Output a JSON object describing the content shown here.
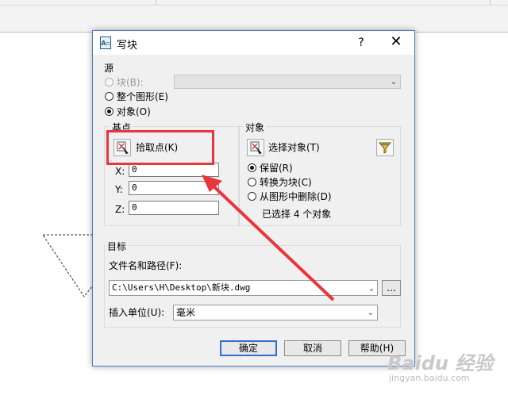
{
  "dialog": {
    "title": "写块",
    "app_icon": "A▫",
    "help_glyph": "?",
    "close_glyph": "✕",
    "source": {
      "label": "源",
      "block_option": "块(B):",
      "entire_drawing_option": "整个图形(E)",
      "objects_option": "对象(O)",
      "selected": "objects"
    },
    "base_point": {
      "label": "基点",
      "pick_point_label": "拾取点(K)",
      "x_label": "X:",
      "y_label": "Y:",
      "z_label": "Z:",
      "x_value": "0",
      "y_value": "0",
      "z_value": "0"
    },
    "objects": {
      "label": "对象",
      "select_objects_label": "选择对象(T)",
      "retain_option": "保留(R)",
      "convert_option": "转换为块(C)",
      "delete_option": "从图形中删除(D)",
      "selected": "retain",
      "selection_status": "已选择 4 个对象"
    },
    "destination": {
      "label": "目标",
      "filename_label": "文件名和路径(F):",
      "filename_value": "C:\\Users\\H\\Desktop\\新块.dwg",
      "browse_label": "...",
      "units_label": "插入单位(U):",
      "units_value": "毫米"
    },
    "buttons": {
      "ok": "确定",
      "cancel": "取消",
      "help": "帮助(H)"
    }
  },
  "watermark": {
    "logo": "Baidu 经验",
    "url": "jingyan.baidu.com"
  },
  "colors": {
    "highlight": "#e8363c",
    "dialog_border": "#4a7ac5"
  }
}
